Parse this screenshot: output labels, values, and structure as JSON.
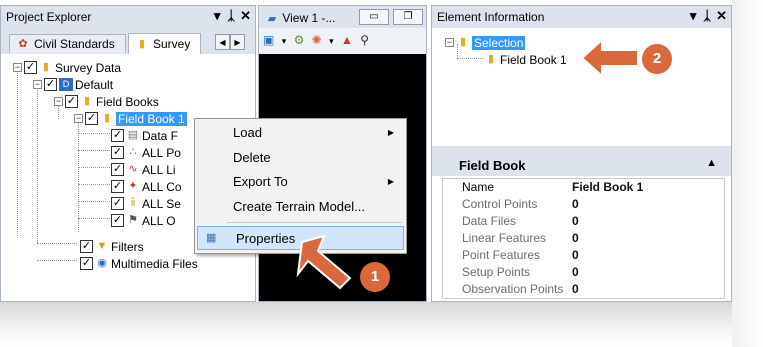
{
  "project_explorer": {
    "title": "Project Explorer",
    "pin_label": "▾ &#x4A;",
    "tabs": [
      "Civil Standards",
      "Survey"
    ],
    "tree": {
      "survey_data": "Survey Data",
      "default": "Default",
      "field_books": "Field Books",
      "field_book_1": "Field Book 1",
      "children": [
        "Data F",
        "ALL Po",
        "ALL Li",
        "ALL Co",
        "ALL Se",
        "ALL O"
      ],
      "filters": "Filters",
      "multimedia": "Multimedia Files"
    }
  },
  "view": {
    "title": "View 1 -..."
  },
  "context_menu": {
    "items": [
      {
        "label": "Load",
        "has_submenu": true
      },
      {
        "label": "Delete",
        "has_submenu": false
      },
      {
        "label": "Export To",
        "has_submenu": true
      },
      {
        "label": "Create Terrain Model...",
        "has_submenu": false
      },
      {
        "label": "Properties",
        "has_submenu": false,
        "highlighted": true
      }
    ]
  },
  "element_info": {
    "title": "Element Information",
    "tree": {
      "selection": "Selection",
      "field_book_1": "Field Book 1"
    },
    "section_title": "Field Book",
    "properties": [
      {
        "key": "Name",
        "value": "Field Book 1"
      },
      {
        "key": "Control Points",
        "value": "0"
      },
      {
        "key": "Data Files",
        "value": "0"
      },
      {
        "key": "Linear Features",
        "value": "0"
      },
      {
        "key": "Point Features",
        "value": "0"
      },
      {
        "key": "Setup Points",
        "value": "0"
      },
      {
        "key": "Observation Points",
        "value": "0"
      }
    ]
  },
  "callouts": [
    "1",
    "2"
  ],
  "colors": {
    "accent": "#d9693d",
    "selection": "#3399ff",
    "menu_highlight": "#d1e6fb"
  }
}
